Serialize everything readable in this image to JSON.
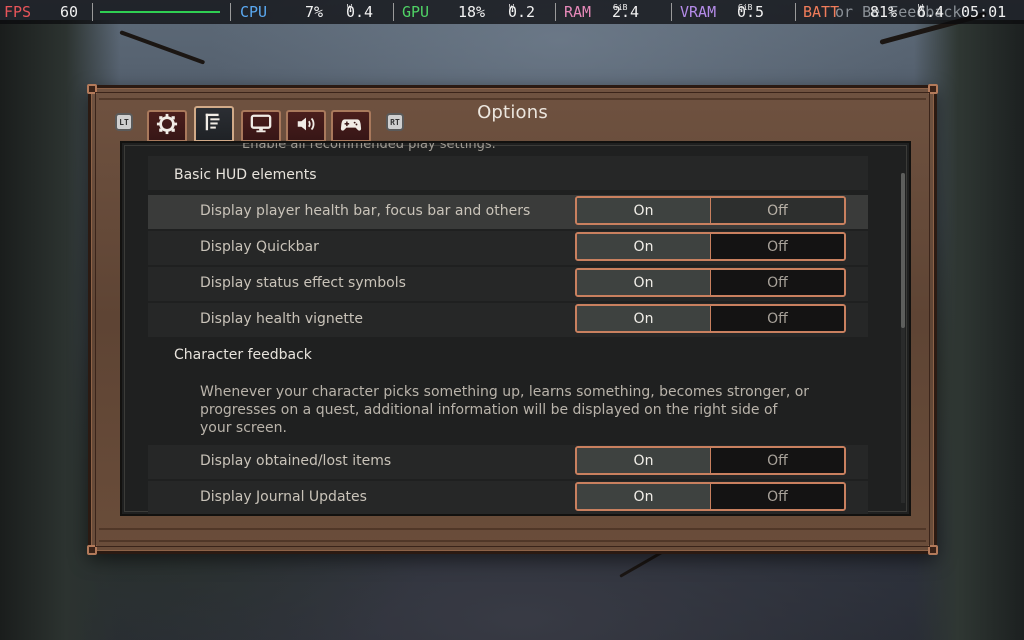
{
  "overlay": {
    "fps_label": "FPS",
    "fps_value": "60",
    "cpu_label": "CPU",
    "cpu_value": "7%",
    "cpu_power": "0.4",
    "cpu_power_unit": "W",
    "gpu_label": "GPU",
    "gpu_value": "18%",
    "gpu_power": "0.2",
    "gpu_power_unit": "W",
    "ram_label": "RAM",
    "ram_value": "2.4",
    "ram_unit": "GiB",
    "vram_label": "VRAM",
    "vram_value": "0.5",
    "vram_unit": "GiB",
    "batt_label": "BATT",
    "batt_value": "81%",
    "batt_power": "6.4",
    "batt_power_unit": "W",
    "clock": "05:01",
    "ghost_text": "or Be Feedback"
  },
  "dialog": {
    "title": "Options",
    "left_bumper": "LT",
    "right_bumper": "RT",
    "tabs": [
      {
        "icon": "gear-icon"
      },
      {
        "icon": "hud-settings-icon",
        "active": true
      },
      {
        "icon": "monitor-icon"
      },
      {
        "icon": "speaker-icon"
      },
      {
        "icon": "gamepad-icon"
      }
    ],
    "clipped_text": "Enable all recommended play settings.",
    "sections": [
      {
        "title": "Basic HUD elements",
        "settings": [
          {
            "label": "Display player health bar, focus bar and others",
            "value": "On",
            "highlighted": true
          },
          {
            "label": "Display Quickbar",
            "value": "On"
          },
          {
            "label": "Display status effect symbols",
            "value": "On"
          },
          {
            "label": "Display health vignette",
            "value": "On"
          }
        ]
      },
      {
        "title": "Character feedback",
        "description": "Whenever your character picks something up, learns something, becomes stronger, or progresses on a quest, additional information will be displayed on the right side of your screen.",
        "settings": [
          {
            "label": "Display obtained/lost items",
            "value": "On"
          },
          {
            "label": "Display Journal Updates",
            "value": "On"
          }
        ]
      }
    ],
    "on_label": "On",
    "off_label": "Off"
  }
}
